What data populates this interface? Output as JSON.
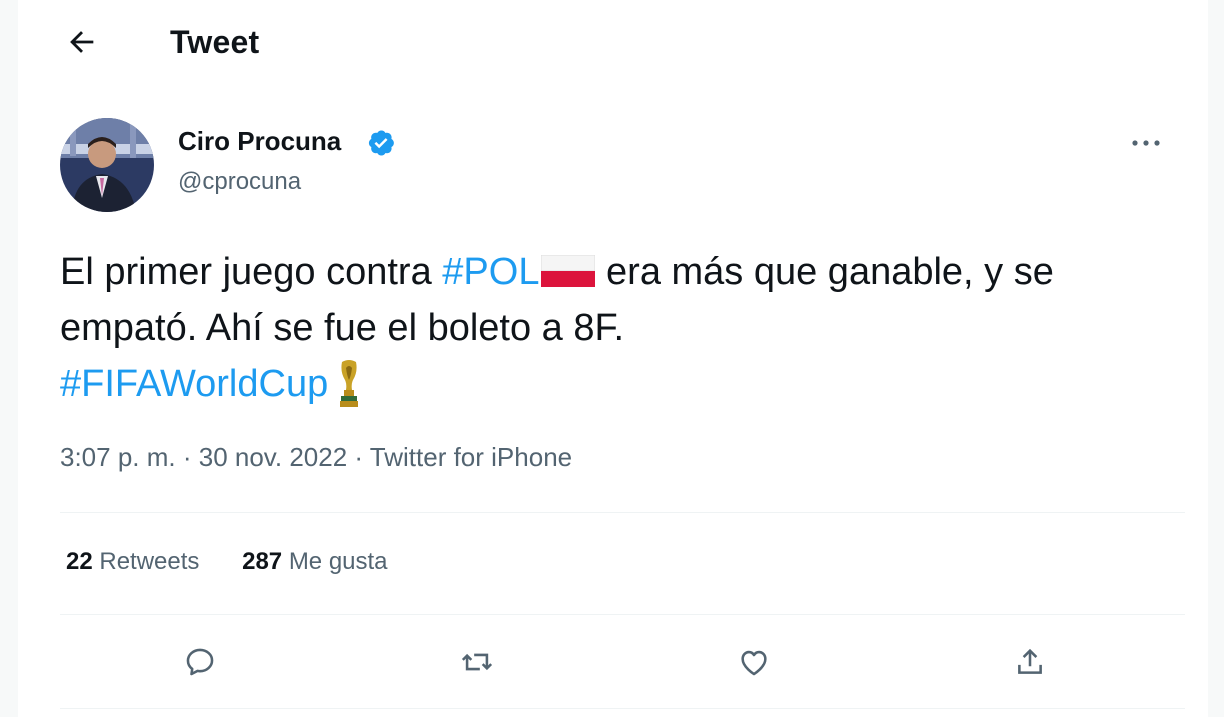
{
  "header": {
    "title": "Tweet"
  },
  "author": {
    "name": "Ciro Procuna",
    "handle": "@cprocuna"
  },
  "tweet": {
    "text_1": "El primer juego contra ",
    "hashtag_pol": "#POL",
    "text_2": " era más que ganable, y se empató. Ahí se fue el boleto a 8F.",
    "hashtag_wc": "#FIFAWorldCup"
  },
  "meta": {
    "time": "3:07 p. m.",
    "sep1": " · ",
    "date": "30 nov. 2022",
    "sep2": " · ",
    "source": "Twitter for iPhone"
  },
  "stats": {
    "retweets_count": "22",
    "retweets_label": "Retweets",
    "likes_count": "287",
    "likes_label": "Me gusta"
  },
  "colors": {
    "hashtag": "#1d9bf0",
    "verified": "#1d9bf0",
    "secondary_text": "#536471"
  },
  "icons": {
    "back": "arrow-left-icon",
    "verified": "verified-badge-icon",
    "more": "more-dots-icon",
    "reply": "reply-icon",
    "retweet": "retweet-icon",
    "like": "heart-icon",
    "share": "share-icon"
  }
}
